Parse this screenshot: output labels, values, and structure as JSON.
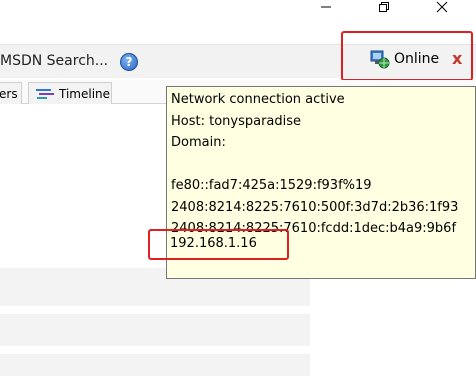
{
  "window": {
    "minimize_icon": "minimize-icon",
    "restore_icon": "restore-icon",
    "close_icon": "close-icon"
  },
  "toolbar": {
    "search_label": "MSDN Search...",
    "help_label": "?"
  },
  "status": {
    "label": "Online",
    "close_label": "x",
    "icon": "network-globe-icon",
    "highlight_color": "#e02020"
  },
  "tabs": [
    {
      "label": "ers"
    },
    {
      "label": "Timeline"
    }
  ],
  "tooltip": {
    "lines": [
      "Network connection active",
      "Host: tonysparadise",
      "Domain:",
      "fe80::fad7:425a:1529:f93f%19",
      "2408:8214:8225:7610:500f:3d7d:2b36:1f93",
      "2408:8214:8225:7610:fcdd:1dec:b4a9:9b6f"
    ],
    "ip": "192.168.1.16",
    "background": "#ffffe1"
  }
}
